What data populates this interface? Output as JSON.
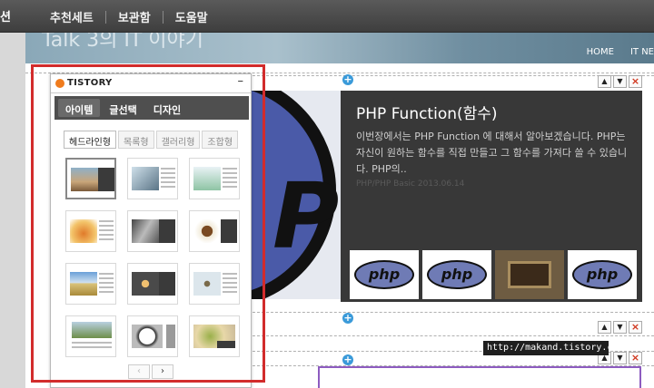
{
  "topbar": {
    "cut_label": "션",
    "items": [
      "추천세트",
      "보관함",
      "도움말"
    ]
  },
  "blog": {
    "title": "Talk 3의 IT 이야기",
    "nav": [
      "HOME",
      "IT NE"
    ]
  },
  "panel": {
    "logo_text": "TISTORY",
    "minimize_label": "–",
    "tabs": [
      "아이템",
      "글선택",
      "디자인"
    ],
    "active_tab": "아이템",
    "subtabs": [
      "헤드라인형",
      "목록형",
      "갤러리형",
      "조합형"
    ],
    "active_subtab": "헤드라인형",
    "layout_count": 12,
    "pager_prev": "‹",
    "pager_next": "›"
  },
  "post": {
    "title": "PHP Function(함수)",
    "excerpt": "이번장에서는 PHP Function 에 대해서 알아보겠습니다. PHP는 자신이 원하는 함수를 직접 만들고 그 함수를 가져다 쓸 수 있습니다. PHP의..",
    "category": "PHP/PHP Basic",
    "date": "2013.06.14",
    "thumbs": [
      "php",
      "php",
      "photo",
      "php"
    ]
  },
  "controls": {
    "up": "▲",
    "down": "▼",
    "close": "×",
    "add": "+"
  },
  "url_tooltip": "http://makand.tistory.com",
  "colors": {
    "highlight": "#d22c2c",
    "accent": "#3a9ad9",
    "logo": "#f07c1e",
    "post_bg": "#383838"
  }
}
